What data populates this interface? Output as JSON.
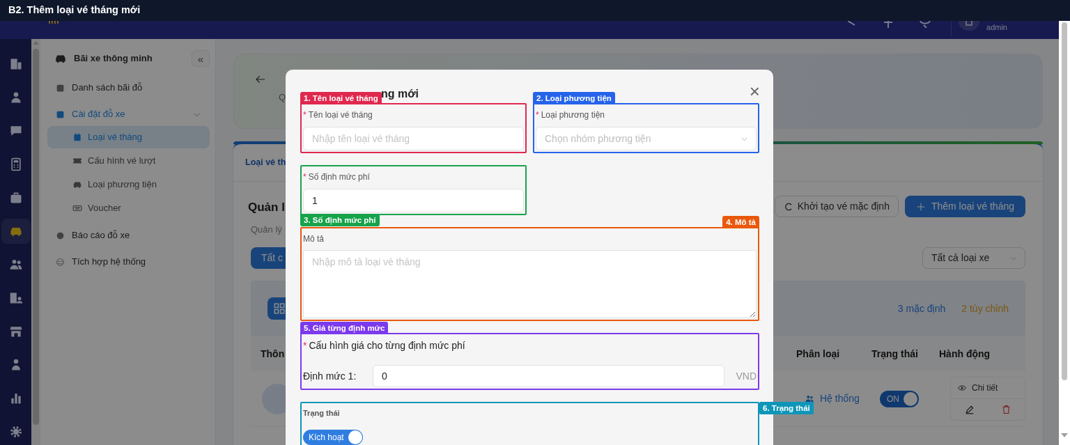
{
  "title_bar": "B2. Thêm loại vé tháng mới",
  "header": {
    "user": "admin"
  },
  "rail": [
    {
      "selected": false
    },
    {
      "selected": false
    },
    {
      "selected": false
    },
    {
      "selected": false
    },
    {
      "selected": false
    },
    {
      "selected": true
    },
    {
      "selected": false
    },
    {
      "selected": false
    },
    {
      "selected": false
    },
    {
      "selected": false
    },
    {
      "selected": false
    },
    {
      "selected": false
    }
  ],
  "sidebar": {
    "title": "Bãi xe thông minh",
    "collapse": "«",
    "items": [
      {
        "label": "Danh sách bãi đỗ",
        "selected": false
      },
      {
        "label": "Cài đặt đỗ xe",
        "selected": true,
        "expanded": true,
        "children": [
          {
            "label": "Loại vé tháng",
            "selected": true
          },
          {
            "label": "Cấu hình vé lượt",
            "selected": false
          },
          {
            "label": "Loại phương tiện",
            "selected": false
          },
          {
            "label": "Voucher",
            "selected": false
          }
        ]
      },
      {
        "label": "Báo cáo đỗ xe",
        "selected": false
      },
      {
        "label": "Tích hợp hệ thống",
        "selected": false
      }
    ]
  },
  "main": {
    "banner_text": "Q",
    "tab": "Loại vé th",
    "heading": "Quản l",
    "subheading": "Quản lý",
    "init_button": "Khởi tạo vé mặc định",
    "add_button": "Thêm loại vé tháng",
    "filter_button": "Tất c",
    "vehicle_filter": "Tất cả loại xe",
    "count_default": "3 mặc định",
    "count_custom": "2 tùy chỉnh",
    "columns": [
      "Thôn",
      "Phân loại",
      "Trạng thái",
      "Hành động"
    ],
    "row": {
      "category": "Hệ thống",
      "on": true,
      "status": "ON",
      "detail": "Chi tiết"
    }
  },
  "modal": {
    "title": "ng mới",
    "close": "×",
    "sections": [
      {
        "kind": "text",
        "required_mark": "*",
        "label": "Tên loại vé tháng",
        "placeholder": "Nhập tên loại vé tháng",
        "annotation": {
          "label": "1. Tên loại vé tháng",
          "color": "#e0284f"
        }
      },
      {
        "kind": "select",
        "required_mark": "*",
        "label": "Loại phương tiện",
        "placeholder": "Chọn nhóm phương tiện",
        "annotation": {
          "label": "2. Loại phương tiện",
          "color": "#2563eb"
        }
      },
      {
        "kind": "number",
        "required_mark": "*",
        "label": "Số định mức phí",
        "value": "1",
        "annotation": {
          "label": "3. Số định mức phí",
          "color": "#16a34a"
        }
      },
      {
        "kind": "textarea",
        "label": "Mô tả",
        "placeholder": "Nhập mô tả loại vé tháng",
        "annotation": {
          "label": "4. Mô tả",
          "color": "#ea580c"
        }
      },
      {
        "kind": "price",
        "required_mark": "*",
        "label": "Cấu hình giá cho từng định mức phí",
        "rows": [
          {
            "label": "Định mức 1:",
            "value": "0",
            "unit": "VND"
          }
        ],
        "annotation": {
          "label": "5. Giá từng định mức",
          "color": "#7c3aed"
        }
      },
      {
        "kind": "toggle",
        "label": "Trạng thái",
        "on": true,
        "switch_label": "Kích hoạt",
        "annotation": {
          "label": "6. Trạng thái",
          "color": "#0e96b8"
        }
      }
    ]
  }
}
